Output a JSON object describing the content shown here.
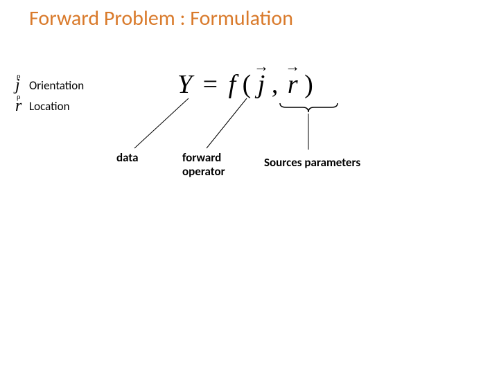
{
  "title": "Forward Problem : Formulation",
  "equation": {
    "lhs": "Y",
    "eq": "=",
    "func": "f",
    "open": "(",
    "arg1_letter": "j",
    "comma": ",",
    "arg2_letter": "r",
    "close": ")",
    "vector_arrow": "→"
  },
  "side_vars": {
    "j_letter": "j",
    "j_arrow": "ρ",
    "j_label": "Orientation",
    "r_letter": "r",
    "r_arrow": "ρ",
    "r_label": "Location"
  },
  "captions": {
    "data": "data",
    "forward_line1": "forward",
    "forward_line2": "operator",
    "sources": "Sources parameters"
  }
}
